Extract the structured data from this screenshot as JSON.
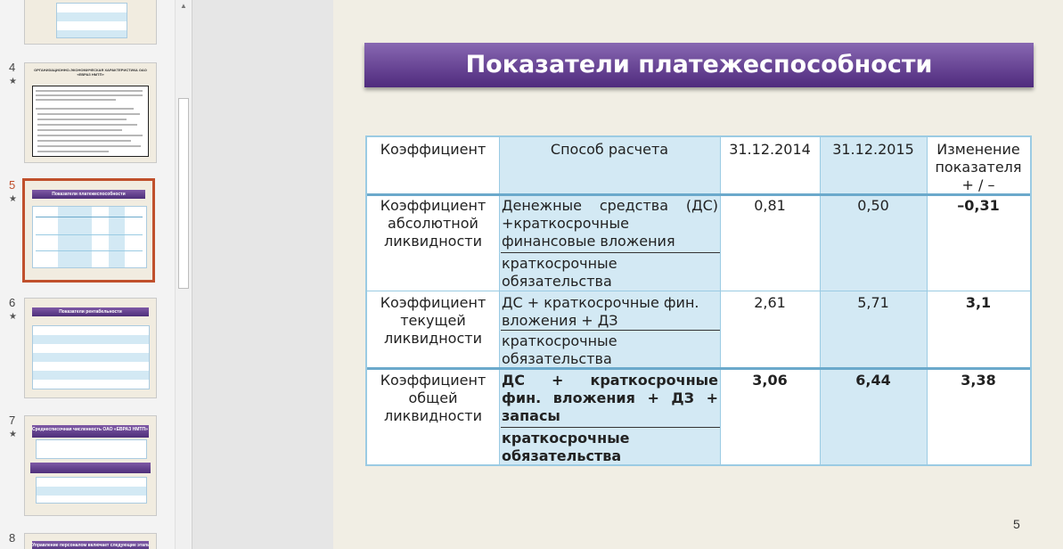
{
  "thumbnails": [
    {
      "number": "",
      "star": false
    },
    {
      "number": "4",
      "star": true,
      "title": "ОРГАНИЗАЦИОННО-ЭКОНОМИЧЕСКАЯ ХАРАКТЕРИСТИКА ОАО «ЕВРАЗ НМТП»"
    },
    {
      "number": "5",
      "star": true,
      "title": "Показатели платежеспособности"
    },
    {
      "number": "6",
      "star": true,
      "title": "Показатели рентабельности"
    },
    {
      "number": "7",
      "star": true,
      "title": "Среднесписочная численность ОАО «ЕВРАЗ НМТП» за 2014 г. в сравнении с 2015 г."
    },
    {
      "number": "8",
      "star": false,
      "title": "Управление персоналом включает следующие этапы"
    }
  ],
  "slide": {
    "title": "Показатели платежеспособности",
    "number": "5",
    "table": {
      "headers": [
        "Коэффициент",
        "Способ расчета",
        "31.12.2014",
        "31.12.2015",
        "Изменение показателя + / –"
      ],
      "rows": [
        {
          "name": "Коэффициент абсолютной ликвидности",
          "numerator": "Денежные средства (ДС) +краткосрочные финансовые вложения",
          "denominator": "краткосрочные обязательства",
          "v2014": "0,81",
          "v2015": "0,50",
          "change": "–0,31"
        },
        {
          "name": "Коэффициент текущей ликвидности",
          "numerator": "ДС + краткосрочные фин. вложения + ДЗ",
          "denominator": "краткосрочные обязательства",
          "v2014": "2,61",
          "v2015": "5,71",
          "change": "3,1"
        },
        {
          "name": "Коэффициент общей ликвидности",
          "numerator": "ДС + краткосрочные фин. вложения + ДЗ + запасы",
          "denominator": "краткосрочные обязательства",
          "v2014": "3,06",
          "v2015": "6,44",
          "change": "3,38"
        }
      ]
    }
  },
  "colors": {
    "title_bar_top": "#8868b2",
    "title_bar_bottom": "#4f2a7d",
    "selected_border": "#c0502c",
    "table_accent": "#d3e9f4",
    "slide_bg": "#f1eee4"
  }
}
